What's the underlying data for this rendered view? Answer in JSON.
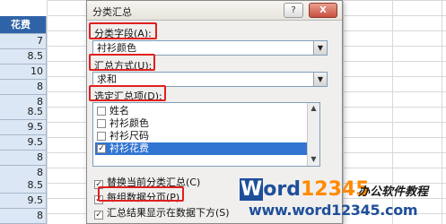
{
  "sheet": {
    "header": "花费",
    "values": [
      "7",
      "8.5",
      "10",
      "8",
      "8",
      "8.5",
      "9.5",
      "9.5",
      "8",
      "8",
      "8.5",
      "9.5",
      "8",
      "8"
    ]
  },
  "dialog": {
    "title": "分类汇总",
    "help_label": "?",
    "close_label": "X",
    "group_field_label": "分类字段(A):",
    "group_field_value": "衬衫颜色",
    "summary_fn_label": "汇总方式(U):",
    "summary_fn_value": "求和",
    "summary_items_label": "选定汇总项(D):",
    "items": [
      {
        "label": "姓名",
        "checked": false
      },
      {
        "label": "衬衫颜色",
        "checked": false
      },
      {
        "label": "衬衫尺码",
        "checked": false
      },
      {
        "label": "衬衫花费",
        "checked": true
      }
    ],
    "replace_current": "替换当前分类汇总(C)",
    "page_break": "每组数据分页(P)",
    "summary_below": "汇总结果显示在数据下方(S)"
  },
  "watermark": {
    "logo_part1": "W",
    "logo_part2": "ord",
    "logo_part3": "12345",
    "tagline": "办公软件教程",
    "url": "www.word12345.com"
  }
}
